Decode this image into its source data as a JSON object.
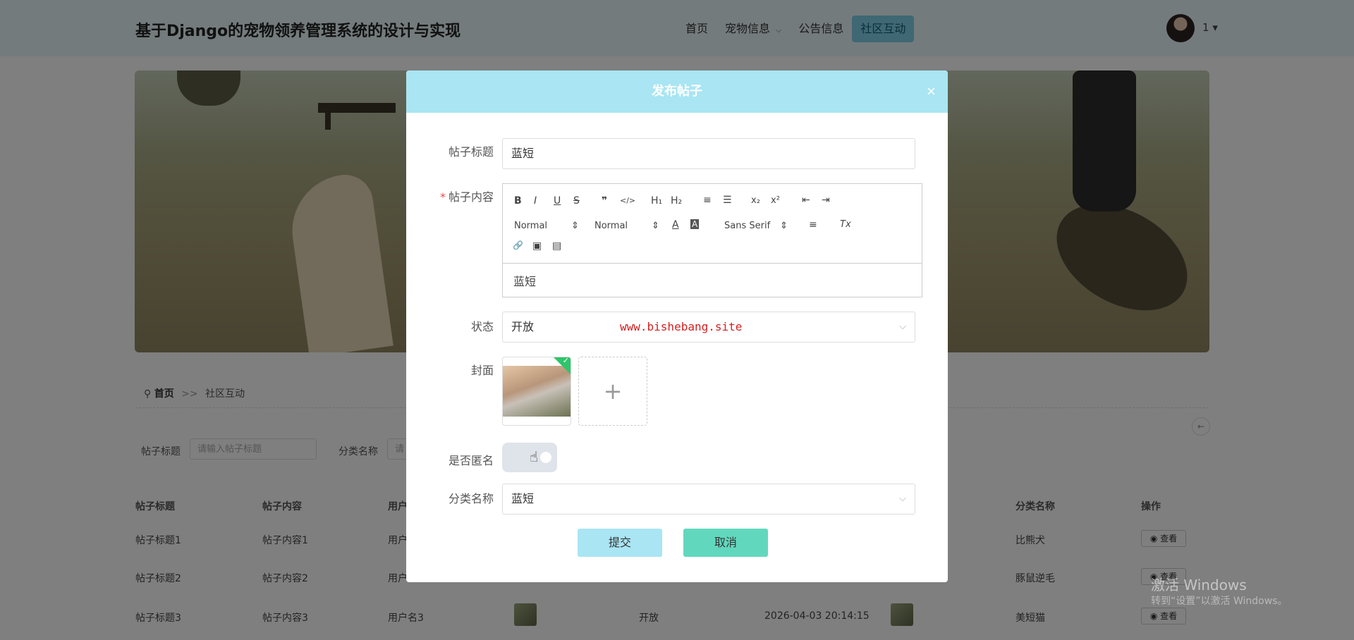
{
  "header": {
    "site_title": "基于Django的宠物领养管理系统的设计与实现",
    "nav": [
      {
        "label": "首页"
      },
      {
        "label": "宠物信息",
        "has_dropdown": true
      },
      {
        "label": "公告信息"
      },
      {
        "label": "社区互动",
        "active": true
      }
    ],
    "user_name": "1"
  },
  "breadcrumb": {
    "home": "首页",
    "separator": ">>",
    "current": "社区互动"
  },
  "search": {
    "title_label": "帖子标题",
    "title_placeholder": "请输入帖子标题",
    "category_label": "分类名称",
    "category_placeholder": "请"
  },
  "table": {
    "headers": [
      "帖子标题",
      "帖子内容",
      "用户名",
      "",
      "",
      "",
      "",
      "分类名称",
      "操作"
    ],
    "rows": [
      {
        "title": "帖子标题1",
        "content": "帖子内容1",
        "user": "用户",
        "category": "比熊犬",
        "action": "查看"
      },
      {
        "title": "帖子标题2",
        "content": "帖子内容2",
        "user": "用户",
        "category": "豚鼠逆毛",
        "action": "查看"
      },
      {
        "title": "帖子标题3",
        "content": "帖子内容3",
        "user": "用户名3",
        "status": "开放",
        "time": "2026-04-03 20:14:15",
        "category": "美短猫",
        "action": "查看"
      }
    ]
  },
  "windows_watermark": {
    "line1": "激活 Windows",
    "line2": "转到“设置”以激活 Windows。"
  },
  "modal": {
    "title": "发布帖子",
    "close": "×",
    "fields": {
      "title_label": "帖子标题",
      "title_value": "蓝短",
      "content_label": "帖子内容",
      "content_required_mark": "*",
      "content_value": "蓝短",
      "status_label": "状态",
      "status_value": "开放",
      "cover_label": "封面",
      "anonymous_label": "是否匿名",
      "category_label": "分类名称",
      "category_value": "蓝短"
    },
    "editor_toolbar": {
      "bold": "B",
      "italic": "I",
      "underline": "U",
      "strike": "S",
      "blockquote": "❞",
      "code": "</>",
      "h1": "H₁",
      "h2": "H₂",
      "ordered_list": "≡",
      "bullet_list": "☰",
      "subscript": "x₂",
      "superscript": "x²",
      "outdent": "⇤",
      "indent": "⇥",
      "size": "Normal",
      "header": "Normal",
      "font_color": "A",
      "bg_color": "A",
      "font": "Sans Serif",
      "align": "≡",
      "clean": "Tx",
      "link": "🔗",
      "image": "▣",
      "video": "▤"
    },
    "watermark": "www.bishebang.site",
    "submit_label": "提交",
    "cancel_label": "取消"
  }
}
